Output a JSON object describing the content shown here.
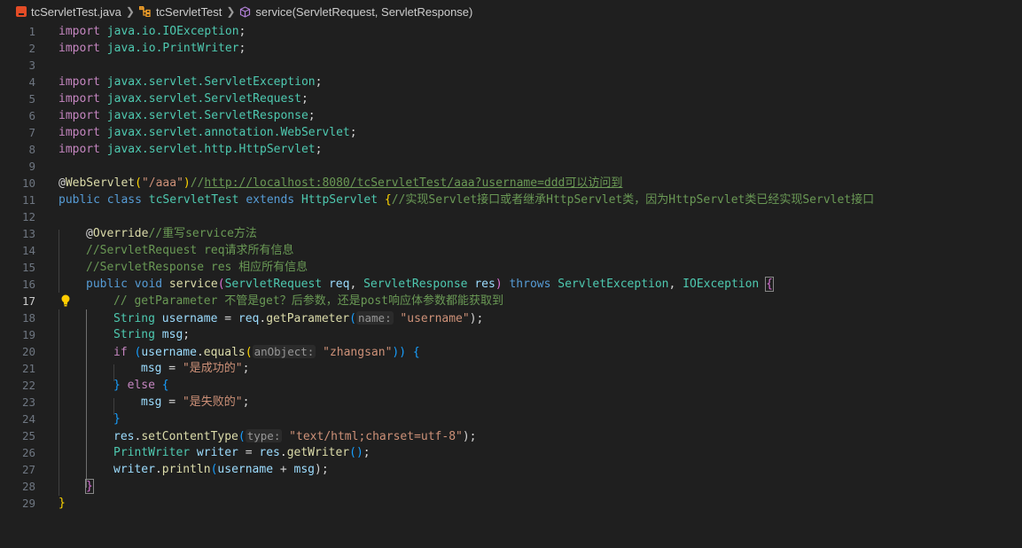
{
  "breadcrumb": {
    "file": "tcServletTest.java",
    "class": "tcServletTest",
    "method": "service(ServletRequest, ServletResponse)"
  },
  "colors": {
    "background": "#1f1f1f",
    "keyword": "#569cd6",
    "type": "#4ec9b0",
    "string": "#ce9178",
    "comment": "#6a9955",
    "function": "#dcdcaa",
    "variable": "#9cdcfe"
  },
  "editor": {
    "current_line": 17,
    "line_numbers": [
      "1",
      "2",
      "3",
      "4",
      "5",
      "6",
      "7",
      "8",
      "9",
      "10",
      "11",
      "12",
      "13",
      "14",
      "15",
      "16",
      "17",
      "18",
      "19",
      "20",
      "21",
      "22",
      "23",
      "24",
      "25",
      "26",
      "27",
      "28",
      "29"
    ],
    "code": {
      "l1_kw": "import",
      "l1_pkg": " java.io.",
      "l1_cls": "IOException",
      "l1_end": ";",
      "l2_kw": "import",
      "l2_pkg": " java.io.",
      "l2_cls": "PrintWriter",
      "l2_end": ";",
      "l4_kw": "import",
      "l4_pkg": " javax.servlet.",
      "l4_cls": "ServletException",
      "l4_end": ";",
      "l5_kw": "import",
      "l5_pkg": " javax.servlet.",
      "l5_cls": "ServletRequest",
      "l5_end": ";",
      "l6_kw": "import",
      "l6_pkg": " javax.servlet.",
      "l6_cls": "ServletResponse",
      "l6_end": ";",
      "l7_kw": "import",
      "l7_pkg": " javax.servlet.annotation.",
      "l7_cls": "WebServlet",
      "l7_end": ";",
      "l8_kw": "import",
      "l8_pkg": " javax.servlet.http.",
      "l8_cls": "HttpServlet",
      "l8_end": ";",
      "l10_at": "@",
      "l10_ann": "WebServlet",
      "l10_p1": "(",
      "l10_str": "\"/aaa\"",
      "l10_p2": ")",
      "l10_com1": "//",
      "l10_link": "http://localhost:8080/tcServletTest/aaa?username=ddd可以访问到",
      "l11_kw1": "public",
      "l11_kw2": " class",
      "l11_cls": " tcServletTest",
      "l11_kw3": " extends",
      "l11_sup": " HttpServlet",
      "l11_brace": " {",
      "l11_com": "//实现Servlet接口或者继承HttpServlet类，因为HttpServlet类已经实现Servlet接口",
      "l13_at": "@",
      "l13_ann": "Override",
      "l13_com": "//重写service方法",
      "l14_com": "//ServletRequest req请求所有信息",
      "l15_com": "//ServletResponse res 相应所有信息",
      "l16_kw1": "public",
      "l16_kw2": " void",
      "l16_fn": " service",
      "l16_p1": "(",
      "l16_t1": "ServletRequest",
      "l16_v1": " req",
      "l16_c": ",",
      "l16_t2": " ServletResponse",
      "l16_v2": " res",
      "l16_p2": ")",
      "l16_kw3": " throws",
      "l16_t3": " ServletException",
      "l16_c2": ",",
      "l16_t4": " IOException",
      "l16_sp": " ",
      "l16_brace": "{",
      "l17_com": "// getParameter 不管是get？后参数，还是post响应体参数都能获取到",
      "l18_t": "String",
      "l18_v": " username",
      "l18_op": " = ",
      "l18_v2": "req",
      "l18_dot": ".",
      "l18_fn": "getParameter",
      "l18_p1": "(",
      "l18_hint": "name:",
      "l18_str": " \"username\"",
      "l18_p2": ");",
      "l19_t": "String",
      "l19_v": " msg",
      "l19_end": ";",
      "l20_kw": "if",
      "l20_p1": " (",
      "l20_v": "username",
      "l20_dot": ".",
      "l20_fn": "equals",
      "l20_p2": "(",
      "l20_hint": "anObject:",
      "l20_str": " \"zhangsan\"",
      "l20_p3": "))",
      "l20_brace": " {",
      "l21_v": "msg",
      "l21_op": " = ",
      "l21_str": "\"是成功的\"",
      "l21_end": ";",
      "l22_brace1": "}",
      "l22_kw": " else",
      "l22_brace2": " {",
      "l23_v": "msg",
      "l23_op": " = ",
      "l23_str": "\"是失败的\"",
      "l23_end": ";",
      "l24_brace": "}",
      "l25_v": "res",
      "l25_dot": ".",
      "l25_fn": "setContentType",
      "l25_p1": "(",
      "l25_hint": "type:",
      "l25_str": " \"text/html;charset=utf-8\"",
      "l25_p2": ");",
      "l26_t": "PrintWriter",
      "l26_v": " writer",
      "l26_op": " = ",
      "l26_v2": "res",
      "l26_dot": ".",
      "l26_fn": "getWriter",
      "l26_p": "()",
      "l26_end": ";",
      "l27_v": "writer",
      "l27_dot": ".",
      "l27_fn": "println",
      "l27_p1": "(",
      "l27_v2": "username",
      "l27_op": " + ",
      "l27_v3": "msg",
      "l27_p2": ");",
      "l28_brace": "}",
      "l29_brace": "}"
    }
  }
}
